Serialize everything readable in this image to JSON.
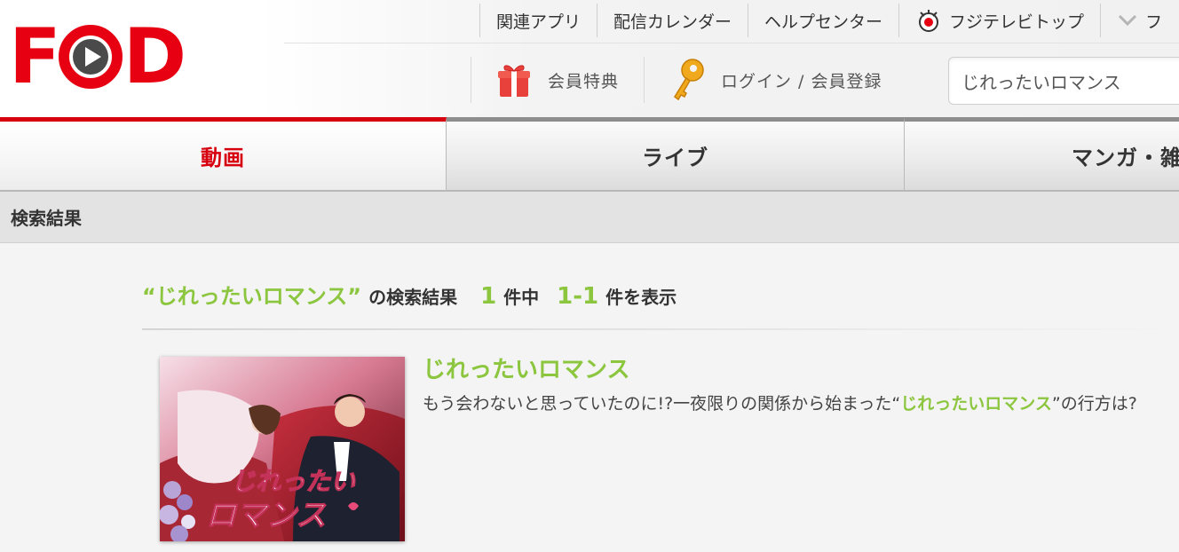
{
  "logo": {
    "text_left": "F",
    "text_right": "D",
    "alt": "FOD"
  },
  "topnav": {
    "items": [
      {
        "label": "関連アプリ"
      },
      {
        "label": "配信カレンダー"
      },
      {
        "label": "ヘルプセンター"
      },
      {
        "label": "フジテレビトップ",
        "icon": "fujitv-eye-icon"
      },
      {
        "label": "フ",
        "icon": "chevron-down-icon"
      }
    ]
  },
  "subnav": {
    "benefits_label": "会員特典",
    "login_label": "ログイン / 会員登録"
  },
  "search": {
    "value": "じれったいロマンス",
    "placeholder": ""
  },
  "tabs": [
    {
      "label": "動画",
      "active": true
    },
    {
      "label": "ライブ",
      "active": false
    },
    {
      "label": "マンガ・雑誌",
      "active": false
    }
  ],
  "results_bar": {
    "label": "検索結果"
  },
  "summary": {
    "keyword": "“じれったいロマンス”",
    "label_results": "の検索結果",
    "total": "1",
    "label_total": "件中",
    "range": "1-1",
    "label_range": "件を表示"
  },
  "result": {
    "title": "じれったいロマンス",
    "desc_before": "もう会わないと思っていたのに!?一夜限りの関係から始まった“",
    "desc_keyword": "じれったいロマンス",
    "desc_after": "”の行方は?",
    "thumb_title_line1": "じれったい",
    "thumb_title_line2": "ロマンス"
  },
  "colors": {
    "brand_red": "#e60012",
    "accent_green": "#8cc63f",
    "active_tab_red": "#d7000f"
  }
}
